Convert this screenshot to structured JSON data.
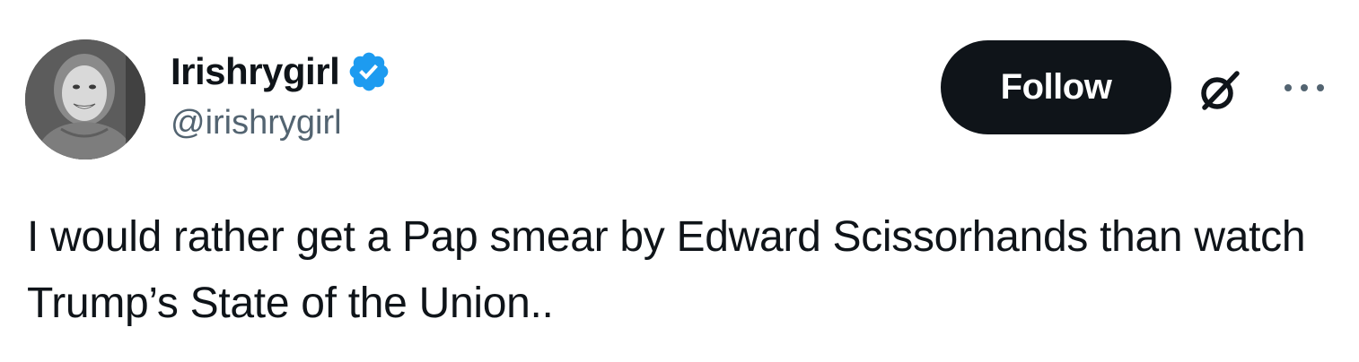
{
  "user": {
    "display_name": "Irishrygirl",
    "handle": "@irishrygirl",
    "verified": true,
    "verified_icon": "verified-badge-icon",
    "verified_color": "#1d9bf0"
  },
  "actions": {
    "follow_label": "Follow",
    "grok_icon": "grok-icon",
    "more_icon": "more-options-icon"
  },
  "tweet": {
    "text": "I would rather get a Pap smear by Edward Scissorhands than watch Trump’s State of the Union.."
  },
  "colors": {
    "text_primary": "#0f1419",
    "text_secondary": "#536471",
    "button_bg": "#0f1419",
    "button_text": "#ffffff"
  }
}
